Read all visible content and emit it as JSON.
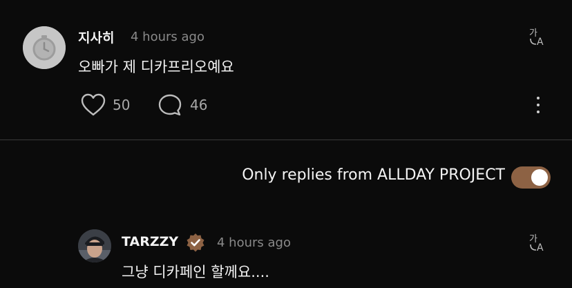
{
  "colors": {
    "background": "#0b0b0b",
    "text_primary": "#f4f4f4",
    "text_secondary": "#8a8a8a",
    "accent_brown": "#8d6244",
    "divider": "#3a3a3a"
  },
  "comment": {
    "author": "지사히",
    "time": "4 hours ago",
    "text": "오빠가 제 디카프리오예요",
    "avatar_icon": "stopwatch-icon",
    "likes": "50",
    "replies": "46",
    "like_icon": "heart-icon",
    "reply_icon": "chat-bubble-icon",
    "translate_icon": "translate-icon",
    "more_icon": "more-vertical-icon"
  },
  "filter": {
    "label": "Only replies from ALLDAY PROJECT",
    "enabled": true
  },
  "reply": {
    "author": "TARZZY",
    "verified": true,
    "verified_icon": "verified-check-icon",
    "time": "4 hours ago",
    "text": "그냥 디카페인 할께요....",
    "translate_icon": "translate-icon"
  }
}
